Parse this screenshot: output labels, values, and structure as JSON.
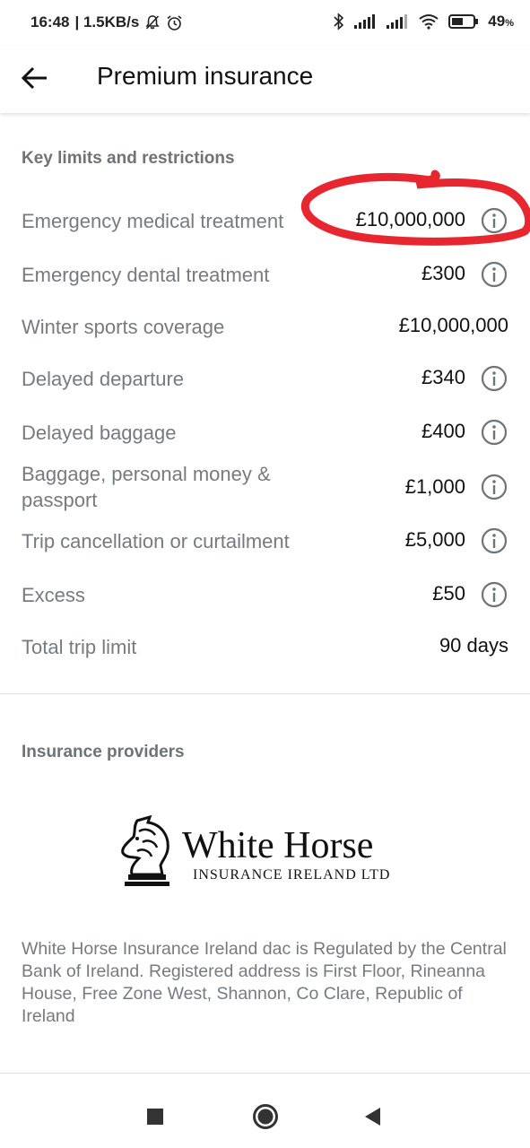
{
  "status_bar": {
    "time": "16:48",
    "speed": "| 1.5KB/s",
    "battery": "49",
    "battery_unit": "%"
  },
  "header": {
    "title": "Premium insurance",
    "back_icon": "arrow-left-icon"
  },
  "limits": {
    "section_title": "Key limits and restrictions",
    "rows": [
      {
        "label": "Emergency medical treatment",
        "value": "£10,000,000",
        "info": true
      },
      {
        "label": "Emergency dental treatment",
        "value": "£300",
        "info": true
      },
      {
        "label": "Winter sports coverage",
        "value": "£10,000,000",
        "info": false
      },
      {
        "label": "Delayed departure",
        "value": "£340",
        "info": true
      },
      {
        "label": "Delayed baggage",
        "value": "£400",
        "info": true
      },
      {
        "label": "Baggage, personal money  &",
        "label2": "passport",
        "value": "£1,000",
        "info": true
      },
      {
        "label": "Trip cancellation or curtailment",
        "value": "£5,000",
        "info": true
      },
      {
        "label": "Excess",
        "value": "£50",
        "info": true
      },
      {
        "label": "Total trip limit",
        "value": "90 days",
        "info": false
      }
    ]
  },
  "providers": {
    "section_title": "Insurance providers",
    "logo_name": "White Horse",
    "logo_sub": "INSURANCE IRELAND LTD",
    "description": "White Horse Insurance Ireland dac is Regulated by the Central Bank of Ireland. Registered address is First Floor, Rineanna House, Free Zone West, Shannon, Co Clare, Republic of Ireland"
  },
  "nav": {
    "recents_icon": "square-icon",
    "home_icon": "circle-icon",
    "back_icon": "triangle-back-icon"
  },
  "colors": {
    "annotation": "#e8262f",
    "label": "#757b80",
    "section": "#6e7378"
  }
}
